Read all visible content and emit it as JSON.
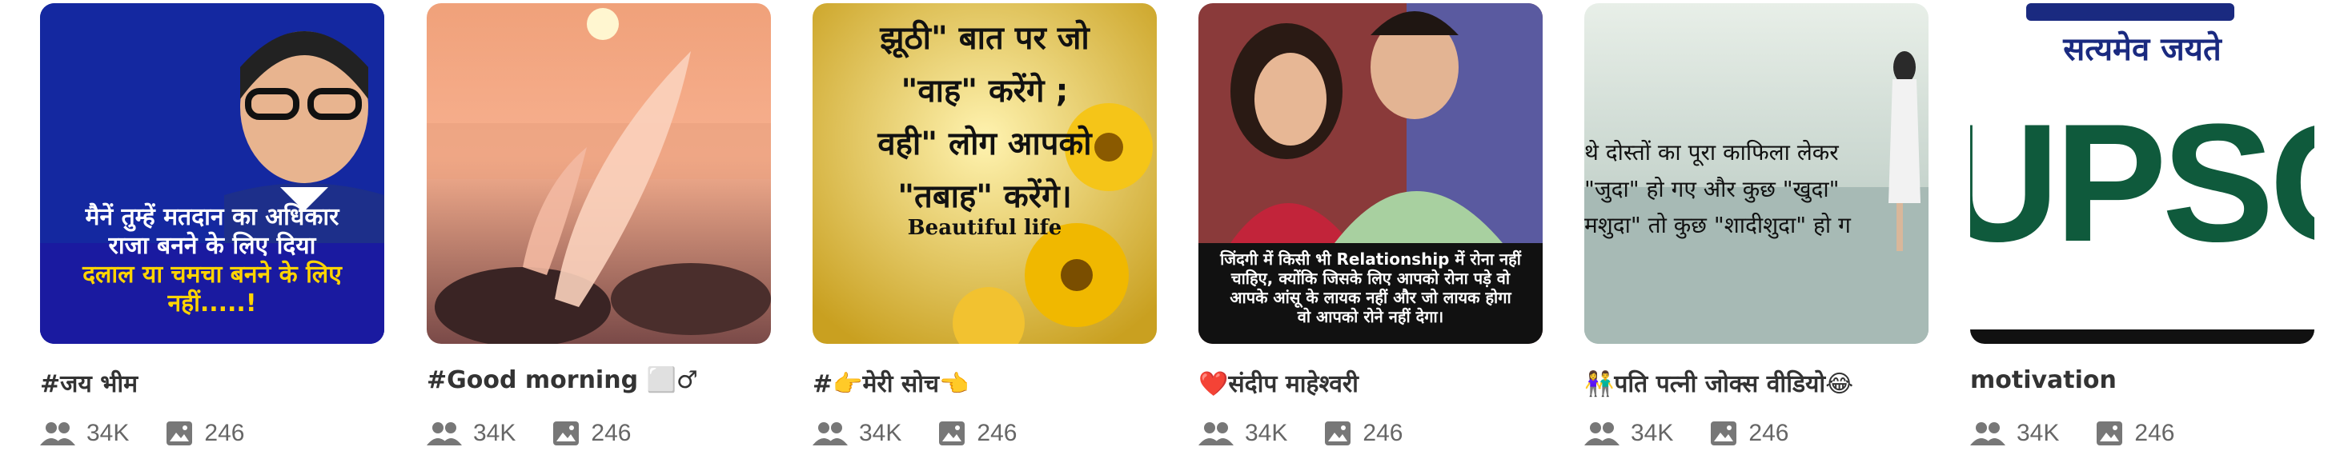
{
  "cards": [
    {
      "title": "#जय भीम",
      "followers": "34K",
      "posts": "246",
      "image_text": [
        "मैनें तुम्हें मतदान  का अधिकार",
        "राजा बनने के लिए दिया",
        "दलाल या चमचा बनने के लिए",
        "नहीं.....!"
      ]
    },
    {
      "title": "#Good morning ⬜♂",
      "followers": "34K",
      "posts": "246"
    },
    {
      "title": "#👉मेरी सोच👈",
      "followers": "34K",
      "posts": "246",
      "image_text": [
        "झूठी\" बात पर जो",
        "\"वाह\" करेंगे ;",
        "वही\" लोग आपको",
        "\"तबाह\" करेंगे।",
        "Beautiful life"
      ]
    },
    {
      "title": "❤️संदीप माहेश्वरी",
      "followers": "34K",
      "posts": "246",
      "image_text": [
        "जिंदगी में किसी भी Relationship में रोना नहीं",
        "चाहिए, क्योंकि जिसके लिए आपको रोना पड़े वो",
        "आपके आंसू के लायक नहीं और जो लायक होगा",
        "वो आपको रोने नहीं देगा।"
      ]
    },
    {
      "title": "👫पति पत्नी जोक्स वीडियो😂",
      "followers": "34K",
      "posts": "246",
      "image_text": [
        "थे दोस्तों का पूरा काफिला लेकर",
        "\"जुदा\" हो गए और कुछ \"खुदा\"",
        "मशुदा\" तो कुछ \"शादीशुदा\" हो ग"
      ]
    },
    {
      "title": "motivation",
      "followers": "34K",
      "posts": "246",
      "image_text": [
        "सत्यमेव जयते",
        "UPSC"
      ]
    }
  ],
  "colors": {
    "title": "#333333",
    "stats": "#666666",
    "icon": "#777777",
    "upsc_green": "#0f5a3c"
  },
  "icons": {
    "followers": "people-icon",
    "posts": "image-icon"
  }
}
